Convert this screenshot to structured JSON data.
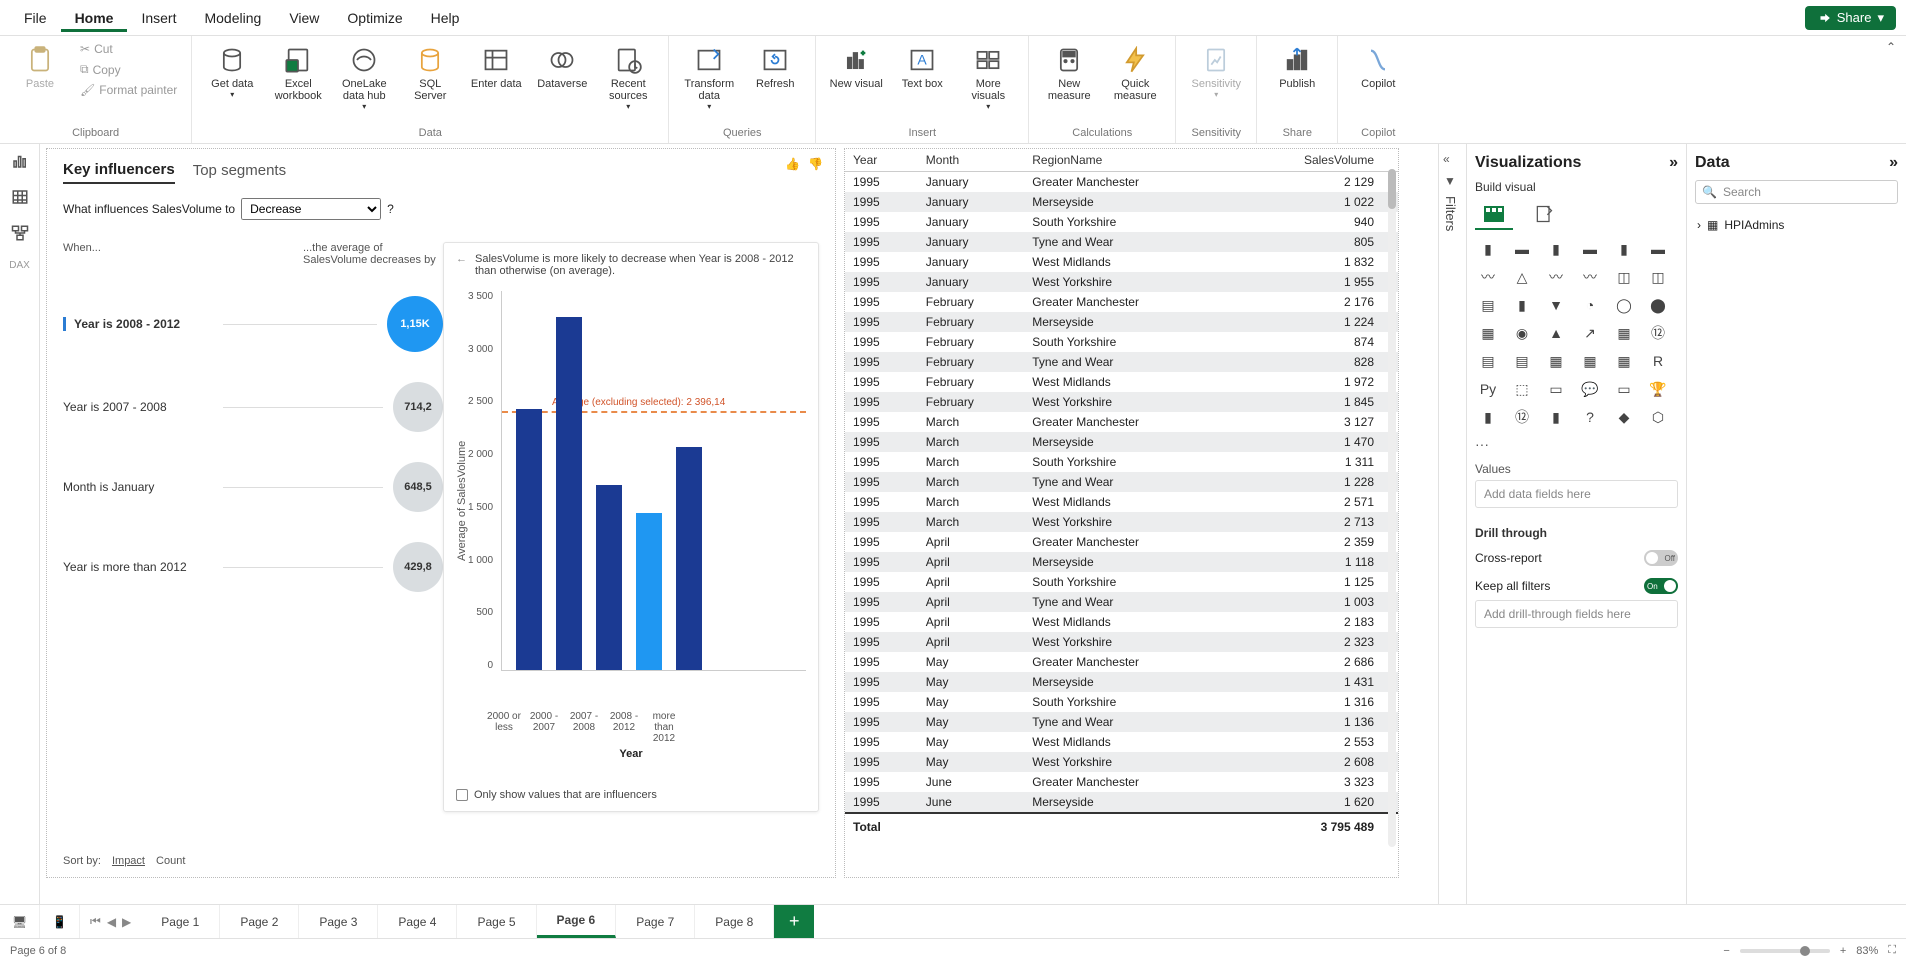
{
  "menubar": [
    "File",
    "Home",
    "Insert",
    "Modeling",
    "View",
    "Optimize",
    "Help"
  ],
  "menubar_active": "Home",
  "share_label": "Share",
  "ribbon": {
    "clipboard": {
      "paste": "Paste",
      "cut": "Cut",
      "copy": "Copy",
      "fmt": "Format painter",
      "group": "Clipboard"
    },
    "data": {
      "get": "Get data",
      "excel": "Excel workbook",
      "onelake": "OneLake data hub",
      "sql": "SQL Server",
      "enter": "Enter data",
      "dataverse": "Dataverse",
      "recent": "Recent sources",
      "group": "Data"
    },
    "queries": {
      "transform": "Transform data",
      "refresh": "Refresh",
      "group": "Queries"
    },
    "insert": {
      "visual": "New visual",
      "text": "Text box",
      "more": "More visuals",
      "group": "Insert"
    },
    "calc": {
      "measure": "New measure",
      "quick": "Quick measure",
      "group": "Calculations"
    },
    "sens": {
      "sens": "Sensitivity",
      "group": "Sensitivity"
    },
    "share": {
      "publish": "Publish",
      "group": "Share"
    },
    "copilot": {
      "copilot": "Copilot",
      "group": "Copilot"
    }
  },
  "left_rail_icons": [
    "report-icon",
    "table-icon",
    "model-icon",
    "dax-icon"
  ],
  "ki": {
    "tab_ki": "Key influencers",
    "tab_seg": "Top segments",
    "question_prefix": "What influences SalesVolume to",
    "direction": "Decrease",
    "qmark": "?",
    "when": "When...",
    "impact_head": "...the average of SalesVolume decreases by",
    "influencers": [
      {
        "label": "Year is 2008 - 2012",
        "value": "1,15K",
        "selected": true
      },
      {
        "label": "Year is 2007 - 2008",
        "value": "714,2"
      },
      {
        "label": "Month is January",
        "value": "648,5"
      },
      {
        "label": "Year is more than 2012",
        "value": "429,8"
      }
    ],
    "sort_by": "Sort by:",
    "sort_impact": "Impact",
    "sort_count": "Count",
    "explain": "SalesVolume is more likely to decrease when Year is 2008 - 2012 than otherwise (on average).",
    "avg_label": "Average (excluding selected): 2 396,14",
    "ylabel": "Average of SalesVolume",
    "xlabel": "Year",
    "only_inf": "Only show values that are influencers"
  },
  "chart_data": {
    "type": "bar",
    "categories": [
      "2000 or less",
      "2000 - 2007",
      "2007 - 2008",
      "2008 - 2012",
      "more than 2012"
    ],
    "values": [
      2400,
      3250,
      1700,
      1450,
      2050
    ],
    "highlight_index": 3,
    "reference_line": 2396.14,
    "title": "",
    "xlabel": "Year",
    "ylabel": "Average of SalesVolume",
    "ylim": [
      0,
      3500
    ],
    "yticks": [
      "3 500",
      "3 000",
      "2 500",
      "2 000",
      "1 500",
      "1 000",
      "500",
      "0"
    ]
  },
  "table": {
    "headers": [
      "Year",
      "Month",
      "RegionName",
      "SalesVolume"
    ],
    "rows": [
      [
        "1995",
        "January",
        "Greater Manchester",
        "2 129"
      ],
      [
        "1995",
        "January",
        "Merseyside",
        "1 022"
      ],
      [
        "1995",
        "January",
        "South Yorkshire",
        "940"
      ],
      [
        "1995",
        "January",
        "Tyne and Wear",
        "805"
      ],
      [
        "1995",
        "January",
        "West Midlands",
        "1 832"
      ],
      [
        "1995",
        "January",
        "West Yorkshire",
        "1 955"
      ],
      [
        "1995",
        "February",
        "Greater Manchester",
        "2 176"
      ],
      [
        "1995",
        "February",
        "Merseyside",
        "1 224"
      ],
      [
        "1995",
        "February",
        "South Yorkshire",
        "874"
      ],
      [
        "1995",
        "February",
        "Tyne and Wear",
        "828"
      ],
      [
        "1995",
        "February",
        "West Midlands",
        "1 972"
      ],
      [
        "1995",
        "February",
        "West Yorkshire",
        "1 845"
      ],
      [
        "1995",
        "March",
        "Greater Manchester",
        "3 127"
      ],
      [
        "1995",
        "March",
        "Merseyside",
        "1 470"
      ],
      [
        "1995",
        "March",
        "South Yorkshire",
        "1 311"
      ],
      [
        "1995",
        "March",
        "Tyne and Wear",
        "1 228"
      ],
      [
        "1995",
        "March",
        "West Midlands",
        "2 571"
      ],
      [
        "1995",
        "March",
        "West Yorkshire",
        "2 713"
      ],
      [
        "1995",
        "April",
        "Greater Manchester",
        "2 359"
      ],
      [
        "1995",
        "April",
        "Merseyside",
        "1 118"
      ],
      [
        "1995",
        "April",
        "South Yorkshire",
        "1 125"
      ],
      [
        "1995",
        "April",
        "Tyne and Wear",
        "1 003"
      ],
      [
        "1995",
        "April",
        "West Midlands",
        "2 183"
      ],
      [
        "1995",
        "April",
        "West Yorkshire",
        "2 323"
      ],
      [
        "1995",
        "May",
        "Greater Manchester",
        "2 686"
      ],
      [
        "1995",
        "May",
        "Merseyside",
        "1 431"
      ],
      [
        "1995",
        "May",
        "South Yorkshire",
        "1 316"
      ],
      [
        "1995",
        "May",
        "Tyne and Wear",
        "1 136"
      ],
      [
        "1995",
        "May",
        "West Midlands",
        "2 553"
      ],
      [
        "1995",
        "May",
        "West Yorkshire",
        "2 608"
      ],
      [
        "1995",
        "June",
        "Greater Manchester",
        "3 323"
      ],
      [
        "1995",
        "June",
        "Merseyside",
        "1 620"
      ]
    ],
    "total_label": "Total",
    "total_value": "3 795 489"
  },
  "filters_label": "Filters",
  "viz_pane": {
    "title": "Visualizations",
    "build": "Build visual",
    "values": "Values",
    "values_placeholder": "Add data fields here",
    "drill": "Drill through",
    "cross": "Cross-report",
    "cross_state": "Off",
    "keep": "Keep all filters",
    "keep_state": "On",
    "drill_placeholder": "Add drill-through fields here",
    "more": "···"
  },
  "data_pane": {
    "title": "Data",
    "search": "Search",
    "table_name": "HPIAdmins"
  },
  "pages": [
    "Page 1",
    "Page 2",
    "Page 3",
    "Page 4",
    "Page 5",
    "Page 6",
    "Page 7",
    "Page 8"
  ],
  "active_page": "Page 6",
  "status": {
    "left": "Page 6 of 8",
    "zoom": "83%"
  }
}
